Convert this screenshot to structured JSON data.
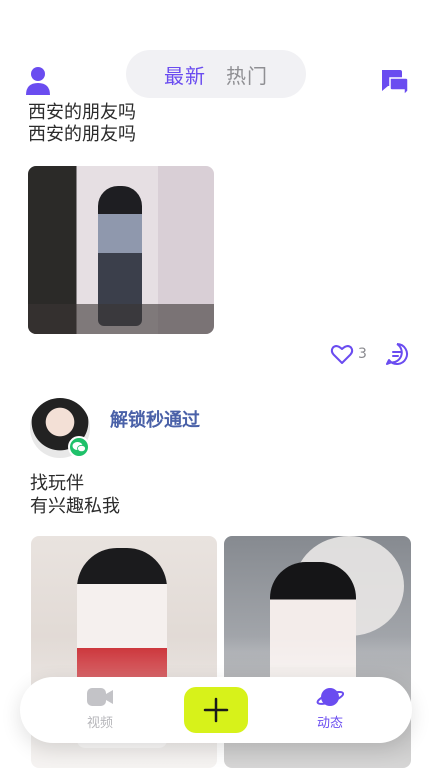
{
  "header": {
    "tabs": [
      {
        "label": "最新",
        "active": true
      },
      {
        "label": "热门",
        "active": false
      }
    ],
    "left_icon": "user-icon",
    "right_icon": "chat-bubbles-icon",
    "accent_color": "#6a4cf0"
  },
  "posts": [
    {
      "text_line1": "西安的朋友吗",
      "text_line2": "西安的朋友吗",
      "likes": "3"
    },
    {
      "username": "解锁秒通过",
      "text_line1": "找玩伴",
      "text_line2": "有兴趣私我",
      "badge_icon": "wechat-icon"
    }
  ],
  "bottom_nav": {
    "items": [
      {
        "label": "视频",
        "icon": "video-camera-icon",
        "active": false
      },
      {
        "label": "动态",
        "icon": "planet-icon",
        "active": true
      }
    ],
    "add_icon": "plus-icon",
    "add_color": "#d7f21a"
  }
}
